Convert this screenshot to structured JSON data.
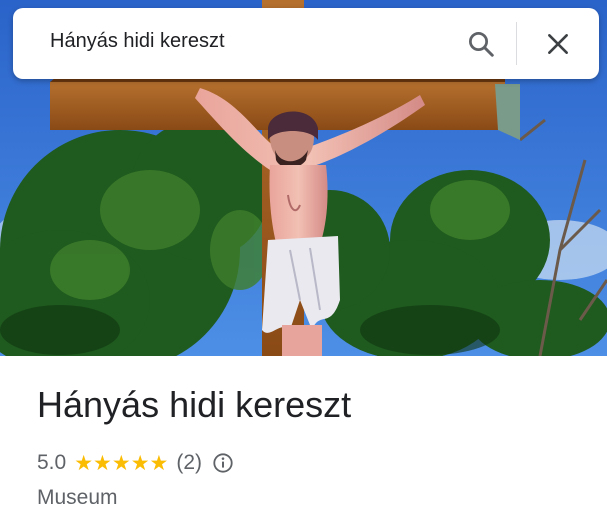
{
  "search": {
    "query": "Hányás hidi kereszt"
  },
  "place": {
    "title": "Hányás hidi kereszt",
    "rating": "5.0",
    "stars": [
      "★",
      "★",
      "★",
      "★",
      "★"
    ],
    "review_count": "(2)",
    "category": "Museum"
  },
  "colors": {
    "sky": "#2f6fd0",
    "foliage": "#1f5a1e",
    "wood": "#a05a1e",
    "star": "#fbbc04",
    "secondary_text": "#5f6368"
  },
  "icons": {
    "search": "search-icon",
    "close": "close-icon",
    "info": "info-icon"
  }
}
